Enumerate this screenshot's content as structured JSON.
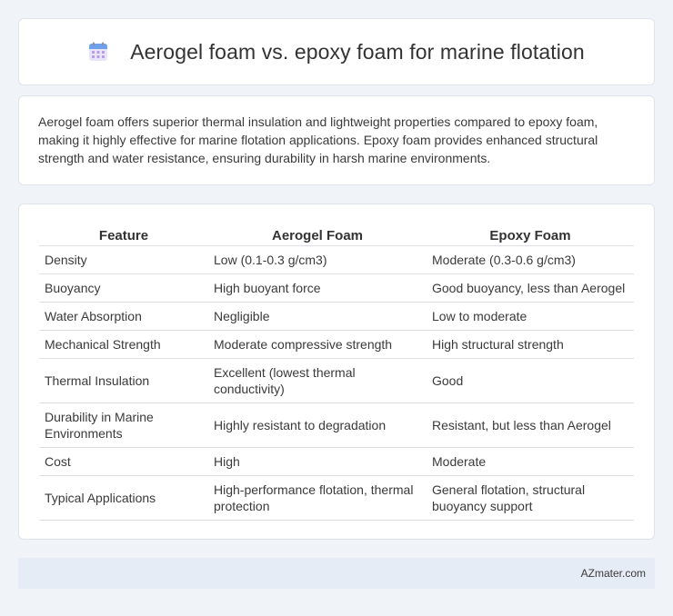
{
  "header": {
    "title": "Aerogel foam vs. epoxy foam for marine flotation",
    "icon": "calendar-icon"
  },
  "intro": {
    "text": "Aerogel foam offers superior thermal insulation and lightweight properties compared to epoxy foam, making it highly effective for marine flotation applications. Epoxy foam provides enhanced structural strength and water resistance, ensuring durability in harsh marine environments."
  },
  "table": {
    "headers": [
      "Feature",
      "Aerogel Foam",
      "Epoxy Foam"
    ],
    "rows": [
      [
        "Density",
        "Low (0.1-0.3 g/cm3)",
        "Moderate (0.3-0.6 g/cm3)"
      ],
      [
        "Buoyancy",
        "High buoyant force",
        "Good buoyancy, less than Aerogel"
      ],
      [
        "Water Absorption",
        "Negligible",
        "Low to moderate"
      ],
      [
        "Mechanical Strength",
        "Moderate compressive strength",
        "High structural strength"
      ],
      [
        "Thermal Insulation",
        "Excellent (lowest thermal conductivity)",
        "Good"
      ],
      [
        "Durability in Marine Environments",
        "Highly resistant to degradation",
        "Resistant, but less than Aerogel"
      ],
      [
        "Cost",
        "High",
        "Moderate"
      ],
      [
        "Typical Applications",
        "High-performance flotation, thermal protection",
        "General flotation, structural buoyancy support"
      ]
    ]
  },
  "footer": {
    "text": "AZmater.com"
  }
}
